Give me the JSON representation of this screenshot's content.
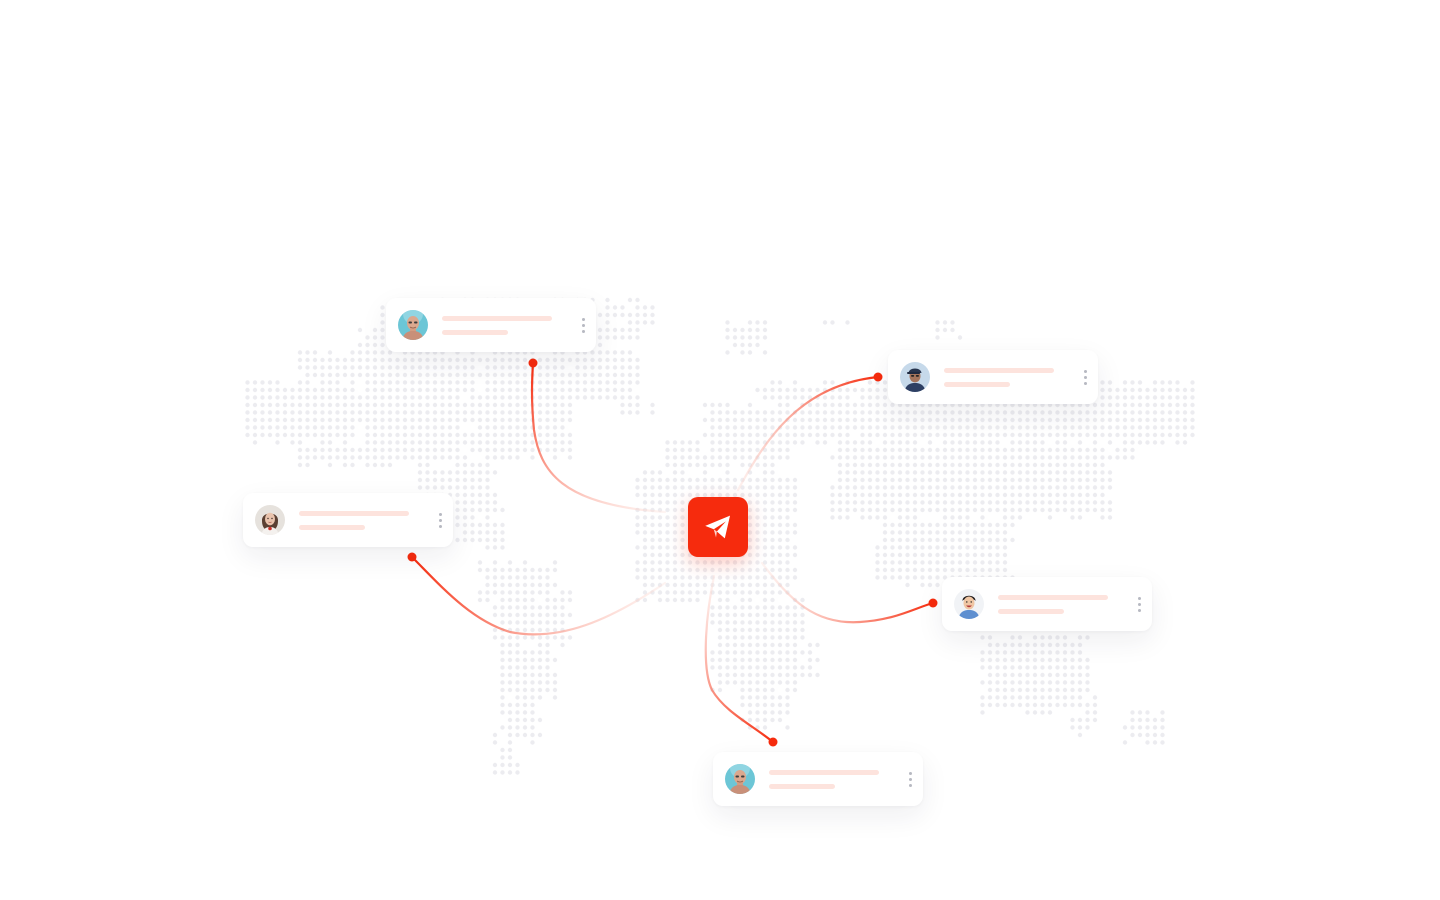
{
  "theme": {
    "accent": "#f62b0d",
    "connector_start": "#fce4de",
    "connector_end": "#f62b0d",
    "placeholder_line": "#fde3dd",
    "map_dot": "#ececf0",
    "card_bg": "#ffffff"
  },
  "hub": {
    "icon": "paper-plane-icon"
  },
  "cards": [
    {
      "id": "top-left",
      "avatar": "man-bald-avatar",
      "menu_icon": "kebab-menu-icon"
    },
    {
      "id": "left",
      "avatar": "woman-avatar",
      "menu_icon": "kebab-menu-icon"
    },
    {
      "id": "top-right",
      "avatar": "man-cap-avatar",
      "menu_icon": "kebab-menu-icon"
    },
    {
      "id": "right",
      "avatar": "smiling-man-avatar",
      "menu_icon": "kebab-menu-icon"
    },
    {
      "id": "bottom",
      "avatar": "man-bald-avatar",
      "menu_icon": "kebab-menu-icon"
    }
  ]
}
